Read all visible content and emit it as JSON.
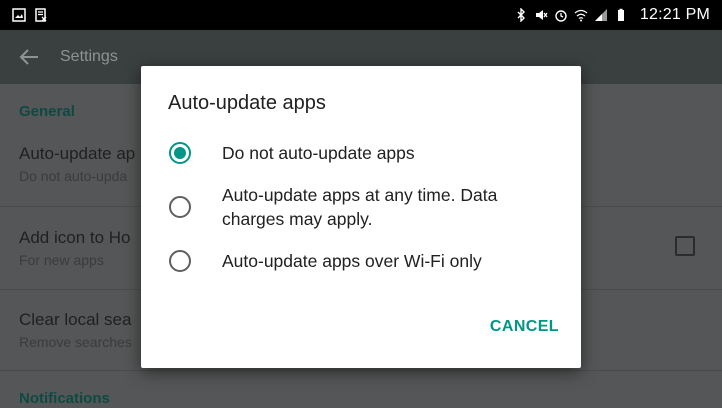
{
  "status_bar": {
    "time": "12:21 PM",
    "left_icons": [
      "image-icon",
      "document-x-icon"
    ],
    "right_icons": [
      "bluetooth-icon",
      "mute-icon",
      "alarm-icon",
      "wifi-icon",
      "signal-icon",
      "battery-icon"
    ]
  },
  "app_bar": {
    "title": "Settings",
    "back_icon": "arrow-left-icon"
  },
  "settings": {
    "general_header": "General",
    "items": [
      {
        "title": "Auto-update ap",
        "summary": "Do not auto-upda"
      },
      {
        "title": "Add icon to Ho",
        "summary": "For new apps"
      },
      {
        "title": "Clear local sea",
        "summary": "Remove searches"
      }
    ],
    "notifications_header": "Notifications"
  },
  "dialog": {
    "title": "Auto-update apps",
    "options": [
      {
        "label": "Do not auto-update apps",
        "checked": true
      },
      {
        "label": "Auto-update apps at any time. Data charges may apply.",
        "checked": false
      },
      {
        "label": "Auto-update apps over Wi-Fi only",
        "checked": false
      }
    ],
    "cancel_label": "CANCEL"
  },
  "colors": {
    "accent": "#009688",
    "app_bar": "#3a3f40",
    "scrim_background": "#545657"
  }
}
